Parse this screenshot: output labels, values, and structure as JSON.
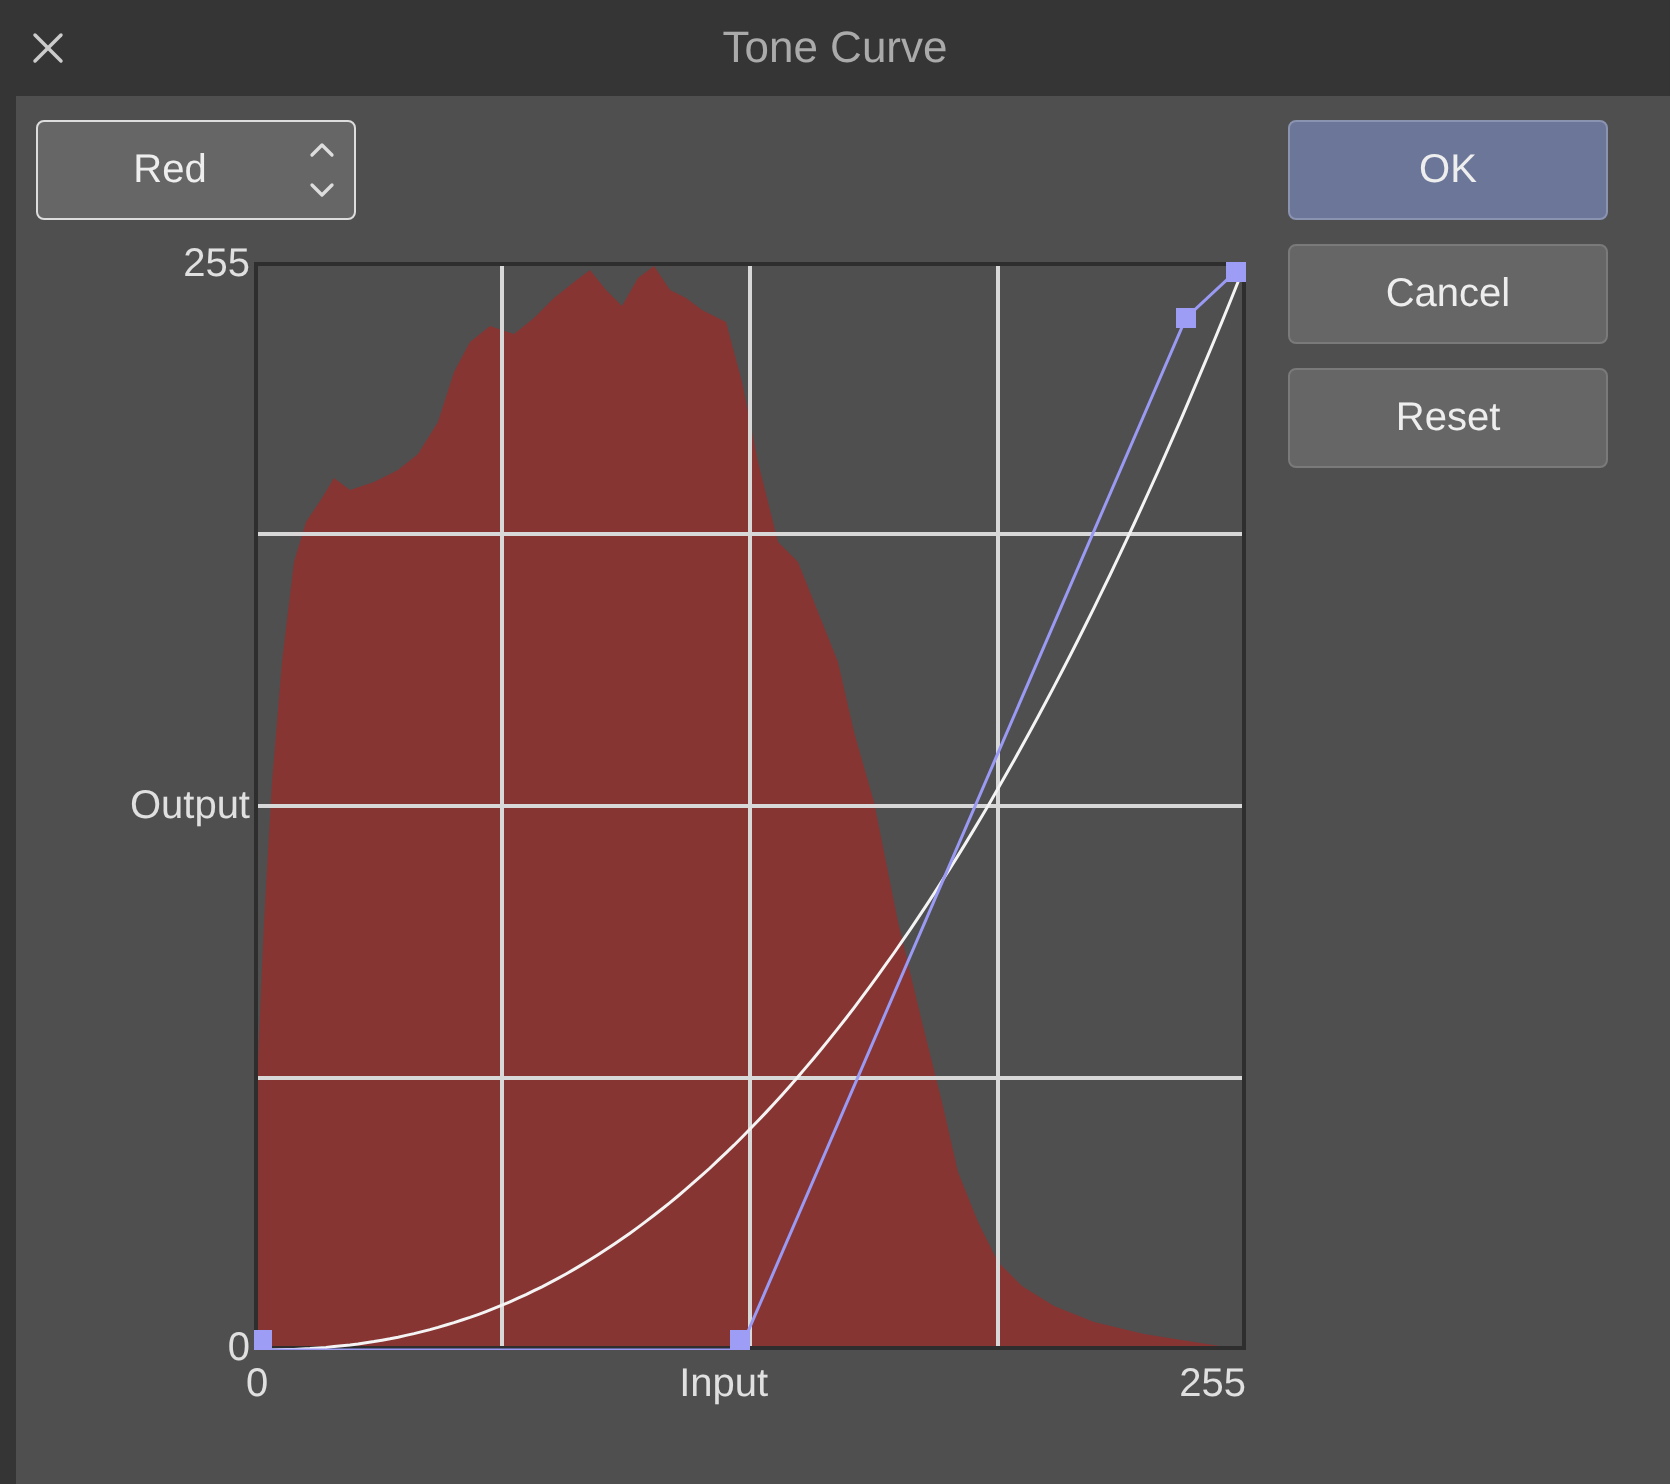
{
  "window": {
    "title": "Tone Curve"
  },
  "channel_select": {
    "value": "Red"
  },
  "graph": {
    "y_labels": [
      "255",
      "Output",
      "0"
    ],
    "x_labels": [
      "0",
      "Input",
      "255"
    ]
  },
  "buttons": [
    {
      "label": "OK",
      "kind": "primary"
    },
    {
      "label": "Cancel",
      "kind": "normal"
    },
    {
      "label": "Reset",
      "kind": "normal"
    }
  ]
}
